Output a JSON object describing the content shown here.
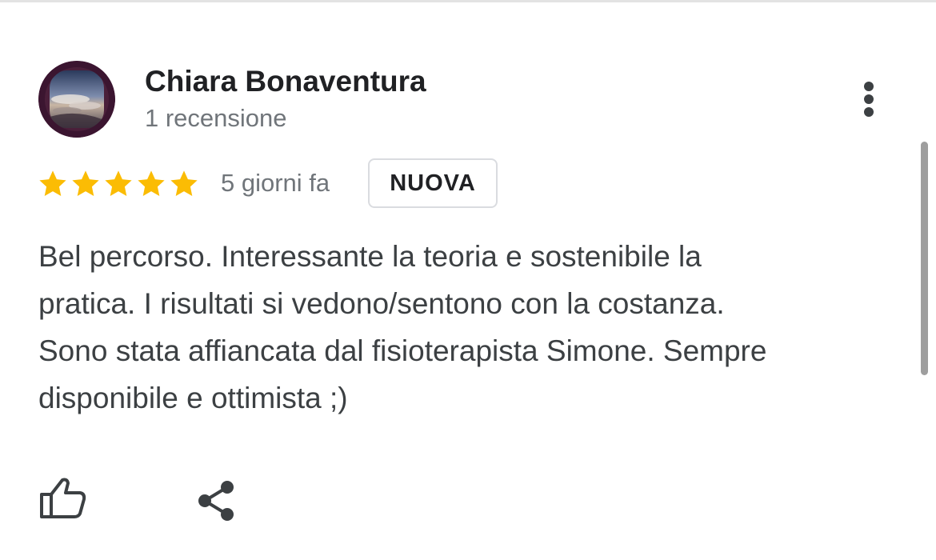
{
  "review": {
    "reviewer_name": "Chiara Bonaventura",
    "review_count": "1 recensione",
    "rating": 5,
    "max_rating": 5,
    "star_color": "#fbbc04",
    "date": "5 giorni fa",
    "badge": "NUOVA",
    "text_lines": [
      "Bel percorso. Interessante la teoria e sostenibile la",
      "pratica. I risultati si vedono/sentono con la costanza.",
      "Sono stata affiancata dal fisioterapista Simone. Sempre",
      "disponibile e ottimista ;)"
    ]
  },
  "icons": {
    "more": "more-vert-icon",
    "like": "thumb-up-icon",
    "share": "share-icon"
  },
  "colors": {
    "text_primary": "#202124",
    "text_secondary": "#70757a",
    "body_text": "#3c4043"
  }
}
